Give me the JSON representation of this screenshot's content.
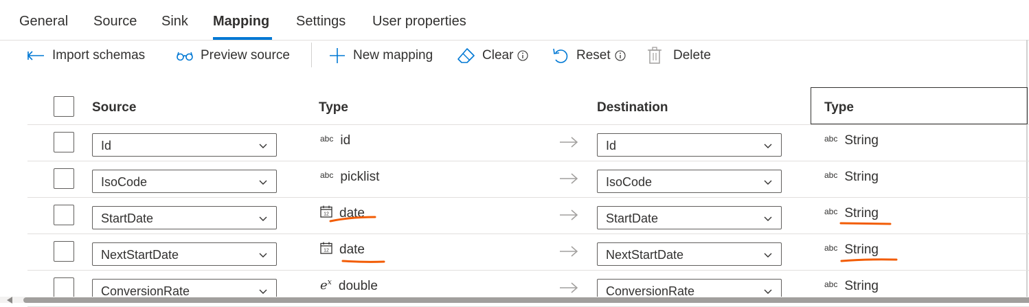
{
  "tabs": [
    "General",
    "Source",
    "Sink",
    "Mapping",
    "Settings",
    "User properties"
  ],
  "active_tab": "Mapping",
  "toolbar": {
    "import_schemas": "Import schemas",
    "preview_source": "Preview source",
    "new_mapping": "New mapping",
    "clear": "Clear",
    "reset": "Reset",
    "delete": "Delete"
  },
  "table": {
    "headers": {
      "source": "Source",
      "source_type": "Type",
      "destination": "Destination",
      "destination_type": "Type"
    },
    "rows": [
      {
        "source": "Id",
        "source_type": "id",
        "source_type_icon": "abc-icon",
        "destination": "Id",
        "destination_type": "String",
        "destination_type_icon": "abc-icon"
      },
      {
        "source": "IsoCode",
        "source_type": "picklist",
        "source_type_icon": "abc-icon",
        "destination": "IsoCode",
        "destination_type": "String",
        "destination_type_icon": "abc-icon"
      },
      {
        "source": "StartDate",
        "source_type": "date",
        "source_type_icon": "calendar-icon",
        "destination": "StartDate",
        "destination_type": "String",
        "destination_type_icon": "abc-icon"
      },
      {
        "source": "NextStartDate",
        "source_type": "date",
        "source_type_icon": "calendar-icon",
        "destination": "NextStartDate",
        "destination_type": "String",
        "destination_type_icon": "abc-icon"
      },
      {
        "source": "ConversionRate",
        "source_type": "double",
        "source_type_icon": "exponent-icon",
        "destination": "ConversionRate",
        "destination_type": "String",
        "destination_type_icon": "abc-icon"
      }
    ]
  },
  "icon_glyphs": {
    "abc": "abc",
    "exponent_base": "e",
    "exponent_power": "x",
    "calendar_day": "12"
  },
  "colors": {
    "accent": "#0078d4",
    "annotation": "#f25c05",
    "text": "#323130",
    "border": "#605e5c"
  }
}
